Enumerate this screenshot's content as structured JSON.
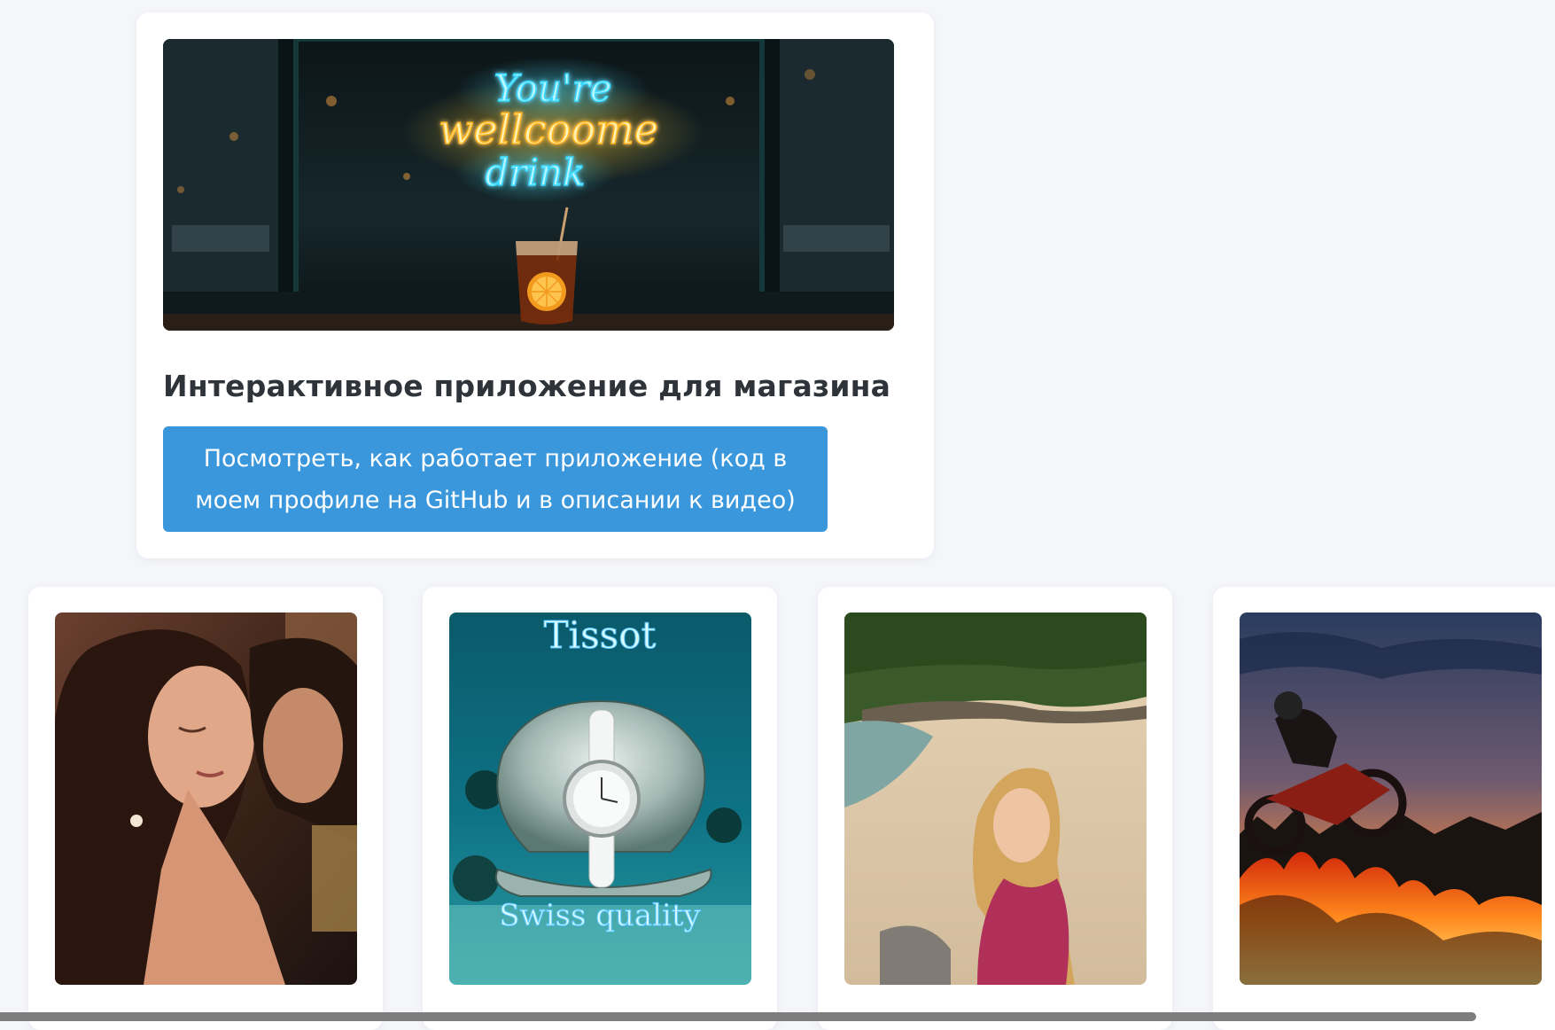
{
  "featured": {
    "image": {
      "neon_line1": "You're",
      "neon_line2": "wellcoome",
      "neon_line3": "drink"
    },
    "title": "Интерактивное приложение для магазина",
    "button": {
      "line1": "Посмотреть, как работает приложение (код в",
      "line2": "моем профиле на GitHub и в описании к видео)"
    }
  },
  "gallery": {
    "items": [
      {
        "icon": "photo"
      },
      {
        "icon": "photo",
        "caption_top": "Tissot",
        "caption_bottom": "Swiss quality"
      },
      {
        "icon": "photo"
      },
      {
        "icon": "photo"
      }
    ]
  },
  "colors": {
    "background": "#f5f6fa",
    "card": "#ffffff",
    "accent": "#3a97dc",
    "title": "#2f343b",
    "scrollbar": "#7d7d7d"
  }
}
